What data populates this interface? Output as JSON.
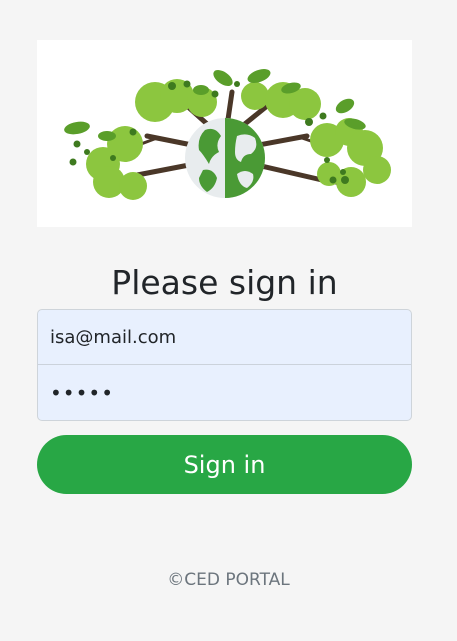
{
  "logo": {
    "name": "earth-tree-logo",
    "colors": {
      "leaf_light": "#8cc63f",
      "leaf_dark": "#5a9e2a",
      "trunk": "#4a3728",
      "globe_land": "#4a9a35",
      "globe_ocean": "#e8ecee"
    }
  },
  "form": {
    "heading": "Please sign in",
    "email_value": "isa@mail.com",
    "password_value": "•••••",
    "signin_label": "Sign in"
  },
  "footer": {
    "text": "©CED PORTAL"
  },
  "theme": {
    "page_bg": "#f5f5f5",
    "input_bg": "#e8f0fe",
    "button_bg": "#28a745",
    "footer_color": "#6c757d"
  }
}
